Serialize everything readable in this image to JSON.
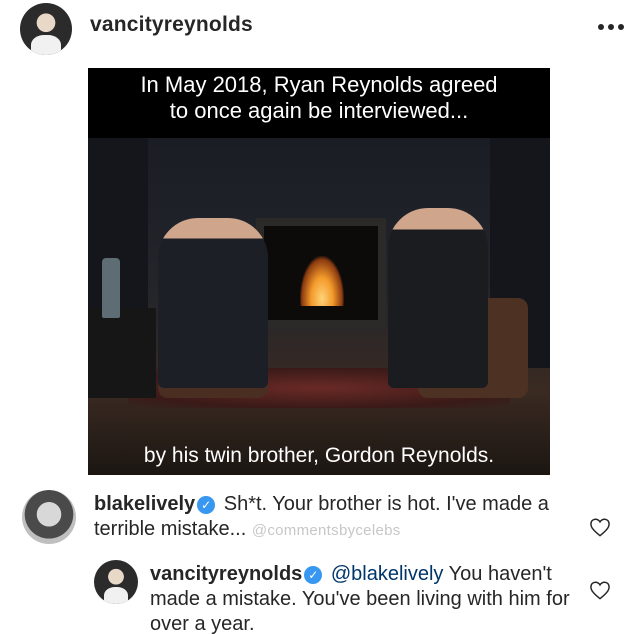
{
  "post": {
    "username": "vancityreynolds",
    "more_icon": "more-horizontal-icon"
  },
  "video": {
    "caption_top_line1": "In May 2018, Ryan Reynolds agreed",
    "caption_top_line2": "to once again be interviewed...",
    "caption_bottom": "by his twin brother, Gordon Reynolds."
  },
  "comments": [
    {
      "username": "blakelively",
      "verified": true,
      "text": "Sh*t. Your brother is hot. I've made a terrible mistake...",
      "watermark": "@commentsbycelebs",
      "like_icon": "heart-icon"
    },
    {
      "username": "vancityreynolds",
      "verified": true,
      "mention": "@blakelively",
      "text": "You haven't made a mistake. You've been living with him for over a year.",
      "like_icon": "heart-icon"
    }
  ],
  "colors": {
    "verified_badge": "#3897f0",
    "mention": "#003569",
    "watermark": "#c7c7c7"
  }
}
